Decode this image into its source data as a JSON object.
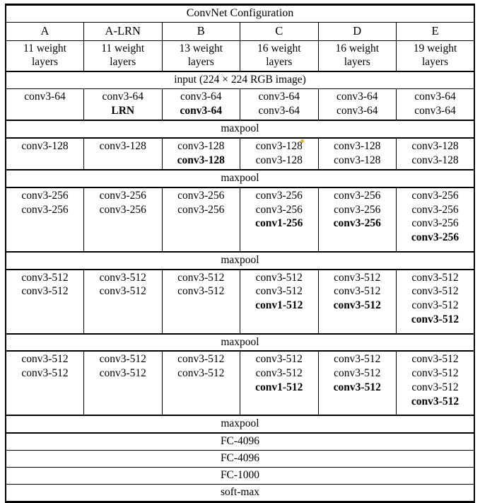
{
  "table": {
    "title": "ConvNet Configuration",
    "columns": [
      {
        "name": "A",
        "layers": "11 weight layers"
      },
      {
        "name": "A-LRN",
        "layers": "11 weight layers"
      },
      {
        "name": "B",
        "layers": "13 weight layers"
      },
      {
        "name": "C",
        "layers": "16 weight layers"
      },
      {
        "name": "D",
        "layers": "16 weight layers"
      },
      {
        "name": "E",
        "layers": "19 weight layers"
      }
    ],
    "input_row": "input (224 × 224 RGB image)",
    "maxpool_label": "maxpool",
    "blocks": [
      {
        "id": "block-64",
        "cells": [
          [
            "conv3-64"
          ],
          [
            "conv3-64",
            "LRN*"
          ],
          [
            "conv3-64",
            "conv3-64*"
          ],
          [
            "conv3-64",
            "conv3-64"
          ],
          [
            "conv3-64",
            "conv3-64"
          ],
          [
            "conv3-64",
            "conv3-64"
          ]
        ]
      },
      {
        "id": "block-128",
        "cells": [
          [
            "conv3-128"
          ],
          [
            "conv3-128"
          ],
          [
            "conv3-128",
            "conv3-128*"
          ],
          [
            "conv3-128",
            "conv3-128"
          ],
          [
            "conv3-128",
            "conv3-128"
          ],
          [
            "conv3-128",
            "conv3-128"
          ]
        ]
      },
      {
        "id": "block-256",
        "cells": [
          [
            "conv3-256",
            "conv3-256"
          ],
          [
            "conv3-256",
            "conv3-256"
          ],
          [
            "conv3-256",
            "conv3-256"
          ],
          [
            "conv3-256",
            "conv3-256",
            "conv1-256*"
          ],
          [
            "conv3-256",
            "conv3-256",
            "conv3-256*"
          ],
          [
            "conv3-256",
            "conv3-256",
            "conv3-256",
            "conv3-256*"
          ]
        ]
      },
      {
        "id": "block-512-a",
        "cells": [
          [
            "conv3-512",
            "conv3-512"
          ],
          [
            "conv3-512",
            "conv3-512"
          ],
          [
            "conv3-512",
            "conv3-512"
          ],
          [
            "conv3-512",
            "conv3-512",
            "conv1-512*"
          ],
          [
            "conv3-512",
            "conv3-512",
            "conv3-512*"
          ],
          [
            "conv3-512",
            "conv3-512",
            "conv3-512",
            "conv3-512*"
          ]
        ]
      },
      {
        "id": "block-512-b",
        "cells": [
          [
            "conv3-512",
            "conv3-512"
          ],
          [
            "conv3-512",
            "conv3-512"
          ],
          [
            "conv3-512",
            "conv3-512"
          ],
          [
            "conv3-512",
            "conv3-512",
            "conv1-512*"
          ],
          [
            "conv3-512",
            "conv3-512",
            "conv3-512*"
          ],
          [
            "conv3-512",
            "conv3-512",
            "conv3-512",
            "conv3-512*"
          ]
        ]
      }
    ],
    "footer_rows": [
      "FC-4096",
      "FC-4096",
      "FC-1000",
      "soft-max"
    ]
  },
  "colors": {
    "rule": "#000000",
    "text": "#000000",
    "background": "#ffffff",
    "artifact": "#f0b428"
  }
}
